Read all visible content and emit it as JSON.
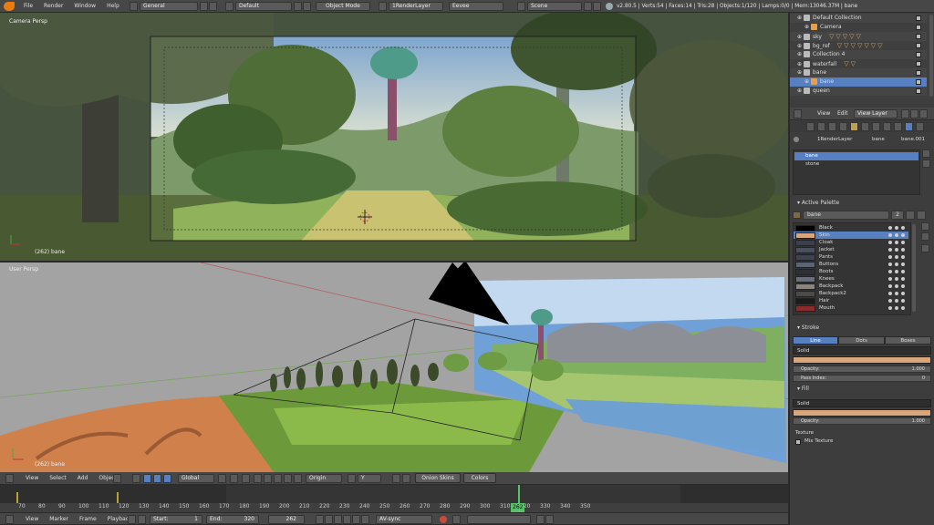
{
  "top_menu": {
    "items": [
      "File",
      "Render",
      "Window",
      "Help"
    ],
    "screen_layout": "General",
    "scene_layout": "Default",
    "mode": "Object Mode",
    "render_layer": "1RenderLayer",
    "engine": "Eevee",
    "scene": "Scene",
    "stats": "v2.80.5 | Verts:54 | Faces:14 | Tris:28 | Objects:1/120 | Lamps:0/0 | Mem:13046.37M | bane"
  },
  "viewport_top": {
    "label": "Camera Persp",
    "frame_label": "(262) bane"
  },
  "viewport_bottom": {
    "label": "User Persp",
    "frame_label": "(262) bane"
  },
  "view_header": {
    "items": [
      "View",
      "Select",
      "Add",
      "Object"
    ],
    "orientation": "Global",
    "pivot": "Origin",
    "axis": "Y",
    "onion_label": "Onion Skins",
    "colors_label": "Colors"
  },
  "timeline": {
    "ticks": [
      "70",
      "80",
      "90",
      "100",
      "110",
      "120",
      "130",
      "140",
      "150",
      "160",
      "170",
      "180",
      "190",
      "200",
      "210",
      "220",
      "230",
      "240",
      "250",
      "260",
      "270",
      "280",
      "290",
      "300",
      "310",
      "320",
      "330",
      "340",
      "350"
    ],
    "menu": [
      "View",
      "Marker",
      "Frame",
      "Playback"
    ],
    "start_label": "Start:",
    "start_value": "1",
    "end_label": "End:",
    "end_value": "320",
    "current_frame": "262",
    "sync": "AV-sync",
    "current_frame_fraction": 0.6
  },
  "outliner": {
    "rows": [
      {
        "label": "Default Collection",
        "icon": "collection-icon"
      },
      {
        "label": "Camera",
        "icon": "camera-icon"
      },
      {
        "label": "sky",
        "icon": "collection-icon"
      },
      {
        "label": "bg_ref",
        "icon": "collection-icon"
      },
      {
        "label": "Collection 4",
        "icon": "collection-icon"
      },
      {
        "label": "waterfall",
        "icon": "collection-icon"
      },
      {
        "label": "bane",
        "icon": "collection-icon"
      },
      {
        "label": "bane",
        "icon": "gpencil-icon"
      },
      {
        "label": "queen",
        "icon": "collection-icon"
      }
    ]
  },
  "props_header": {
    "items": [
      "View",
      "Edit"
    ],
    "view_layer": "View Layer"
  },
  "props_breadcrumb": [
    "1RenderLayer",
    "bane",
    "bane.001"
  ],
  "layers": {
    "items": [
      "bane",
      "stone"
    ]
  },
  "active_palette": {
    "title": "Active Palette",
    "name": "bane",
    "users": "2",
    "colors": [
      {
        "name": "Black",
        "color": "#000000"
      },
      {
        "name": "Skin",
        "color": "#d9a57b"
      },
      {
        "name": "Cloak",
        "color": "#3b3f4c"
      },
      {
        "name": "Jacket",
        "color": "#4a4f5e"
      },
      {
        "name": "Pants",
        "color": "#3e4452"
      },
      {
        "name": "Buttons",
        "color": "#5b6472"
      },
      {
        "name": "Boots",
        "color": "#2e3036"
      },
      {
        "name": "Knees",
        "color": "#6a6e78"
      },
      {
        "name": "Backpack",
        "color": "#8a857d"
      },
      {
        "name": "Backpack2",
        "color": "#4b4a48"
      },
      {
        "name": "Hair",
        "color": "#1c1c1c"
      },
      {
        "name": "Mouth",
        "color": "#8c2b2b"
      }
    ]
  },
  "stroke": {
    "title": "Stroke",
    "tabs": [
      "Line",
      "Dots",
      "Boxes"
    ],
    "mode": "Solid",
    "opacity_label": "Opacity:",
    "opacity_value": "1.000",
    "pass_label": "Pass Index:",
    "pass_value": "0",
    "swatch_color": "#d9a57b"
  },
  "fill": {
    "title": "Fill",
    "mode": "Solid",
    "opacity_label": "Opacity:",
    "opacity_value": "1.000",
    "texture_label": "Texture",
    "mix_label": "Mix Texture",
    "swatch_color": "#d9a57b"
  },
  "colors": {
    "accent": "#5680c2",
    "orange": "#e7a04a",
    "header_bg": "#474747",
    "panel_bg": "#3d3d3d"
  }
}
